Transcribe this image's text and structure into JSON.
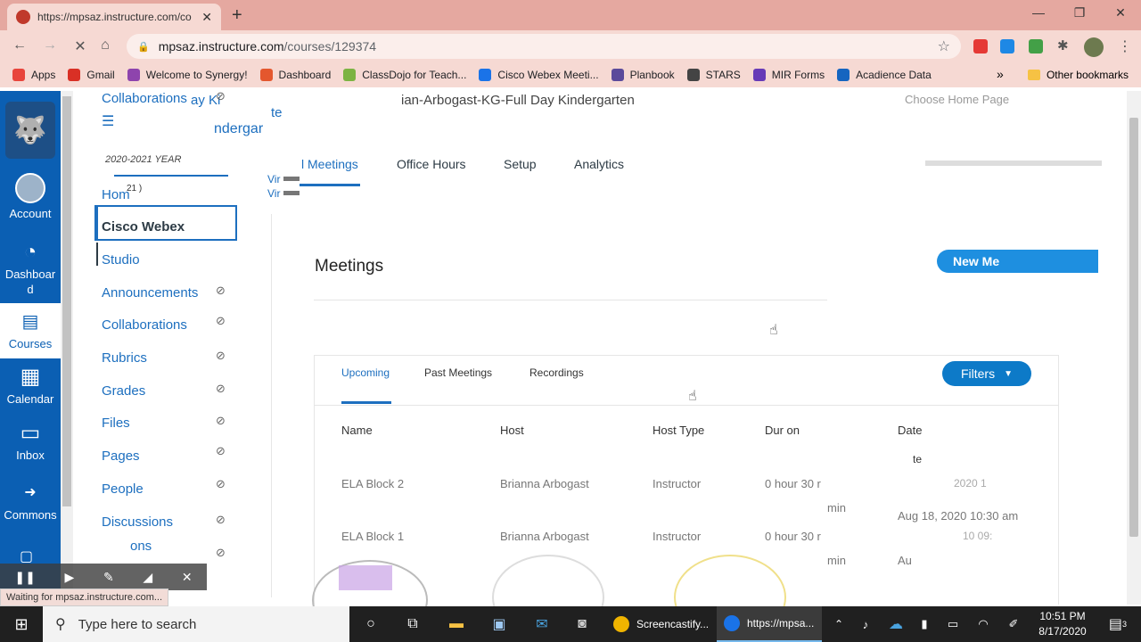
{
  "browser": {
    "tab_title": "https://mpsaz.instructure.com/co",
    "tab_close": "✕",
    "new_tab": "+",
    "url_host": "mpsaz.instructure.com",
    "url_path": "/courses/129374",
    "window": {
      "minimize": "—",
      "restore": "❐",
      "close": "✕"
    }
  },
  "bookmarks": {
    "items": [
      {
        "label": "Apps",
        "color": "#e8453c"
      },
      {
        "label": "Gmail",
        "color": "#d93025"
      },
      {
        "label": "Welcome to Synergy!",
        "color": "#8e44ad"
      },
      {
        "label": "Dashboard",
        "color": "#e4572e"
      },
      {
        "label": "ClassDojo for Teach...",
        "color": "#7cb342"
      },
      {
        "label": "Cisco Webex Meeti...",
        "color": "#1a73e8"
      },
      {
        "label": "Planbook",
        "color": "#5b4a9b"
      },
      {
        "label": "STARS",
        "color": "#444444"
      },
      {
        "label": "MIR Forms",
        "color": "#673ab7"
      },
      {
        "label": "Acadience Data",
        "color": "#1565c0"
      }
    ],
    "more": "»",
    "other": "Other bookmarks"
  },
  "global_nav": {
    "account": "Account",
    "dashboard": "Dashboard",
    "courses": "Courses",
    "calendar": "Calendar",
    "inbox": "Inbox",
    "commons": "Commons"
  },
  "course_nav": {
    "top_item": "Collaborations",
    "top_partial": "ay Ki",
    "year": "2020-2021 YEAR",
    "home": "Hom",
    "home_badge": "21 )",
    "current": "Cisco Webex",
    "items": [
      "Studio",
      "Announcements",
      "Collaborations",
      "Rubrics",
      "Grades",
      "Files",
      "Pages",
      "People",
      "Discussions",
      "ons"
    ]
  },
  "header": {
    "breadcrumb": "ian-Arbogast-KG-Full Day Kindergarten",
    "frag_te": "te",
    "frag_ndergar": "ndergar",
    "frag_vir1": "Vir",
    "frag_vir2": "Vir",
    "choose_home": "Choose Home Page"
  },
  "tabs": {
    "meetings": "l Meetings",
    "office_hours": "Office Hours",
    "setup": "Setup",
    "analytics": "Analytics"
  },
  "meetings": {
    "title": "Meetings",
    "new_button": "New Me",
    "subtabs": {
      "upcoming": "Upcoming",
      "past": "Past Meetings",
      "recordings": "Recordings"
    },
    "filters": "Filters",
    "columns": {
      "name": "Name",
      "host": "Host",
      "host_type": "Host Type",
      "duration": "Dur  on",
      "date": "Date",
      "date_partial": "te"
    },
    "rows": [
      {
        "name": "ELA Block 2",
        "host": "Brianna Arbogast",
        "host_type": "Instructor",
        "duration": "0 hour 30 r",
        "duration_tail": "min",
        "date": "2020 1",
        "date_tail": "Aug 18, 2020 10:30 am"
      },
      {
        "name": "ELA Block 1",
        "host": "Brianna Arbogast",
        "host_type": "Instructor",
        "duration": "0 hour 30 r",
        "duration_tail": "min",
        "date": "10 09:",
        "date_tail": "Au"
      }
    ]
  },
  "status_bar": "Waiting for mpsaz.instructure.com...",
  "taskbar": {
    "search_placeholder": "Type here to search",
    "screencastify": "Screencastify...",
    "chrome": "https://mpsa...",
    "time": "10:51 PM",
    "date": "8/17/2020",
    "notifications": "3"
  }
}
